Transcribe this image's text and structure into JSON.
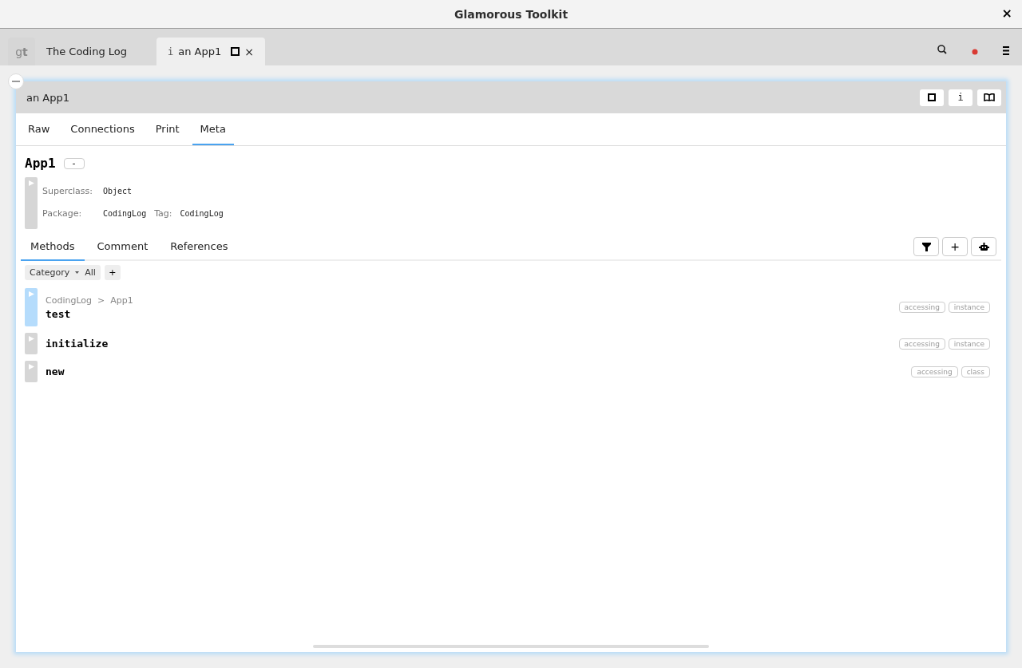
{
  "window": {
    "title": "Glamorous Toolkit",
    "close": "×"
  },
  "tabs": [
    {
      "kind": "logo",
      "label": "g**t**",
      "selected": false
    },
    {
      "kind": "page",
      "label": "The Coding Log",
      "selected": false
    },
    {
      "kind": "inspector",
      "icon": "i",
      "label": "an App1",
      "close": "×",
      "selected": true
    }
  ],
  "inspector": {
    "title": "an App1",
    "info_button": "i",
    "view_tabs": [
      {
        "label": "Raw",
        "selected": false
      },
      {
        "label": "Connections",
        "selected": false
      },
      {
        "label": "Print",
        "selected": false
      },
      {
        "label": "Meta",
        "selected": true
      }
    ],
    "class_name": "App1",
    "class_button": "-",
    "details": {
      "superclass_label": "Superclass:",
      "superclass": "Object",
      "package_label": "Package:",
      "package": "CodingLog",
      "tag_label": "Tag:",
      "tag": "CodingLog"
    },
    "sub_tabs": [
      {
        "label": "Methods",
        "selected": true
      },
      {
        "label": "Comment",
        "selected": false
      },
      {
        "label": "References",
        "selected": false
      }
    ],
    "add_button": "+",
    "filter": {
      "label": "Category",
      "value": "All",
      "add": "+"
    },
    "methods": [
      {
        "name": "test",
        "selected": true,
        "breadcrumb": [
          "CodingLog",
          ">",
          "App1"
        ],
        "tags": [
          "accessing",
          "instance"
        ]
      },
      {
        "name": "initialize",
        "selected": false,
        "tags": [
          "accessing",
          "instance"
        ]
      },
      {
        "name": "new",
        "selected": false,
        "tags": [
          "accessing",
          "class"
        ]
      }
    ]
  }
}
